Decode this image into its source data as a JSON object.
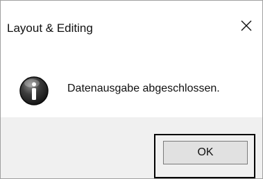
{
  "window": {
    "title": "Layout & Editing",
    "close_icon": "close-icon"
  },
  "content": {
    "icon": "info-icon",
    "message": "Datenausgabe abgeschlossen."
  },
  "footer": {
    "ok_label": "OK"
  }
}
